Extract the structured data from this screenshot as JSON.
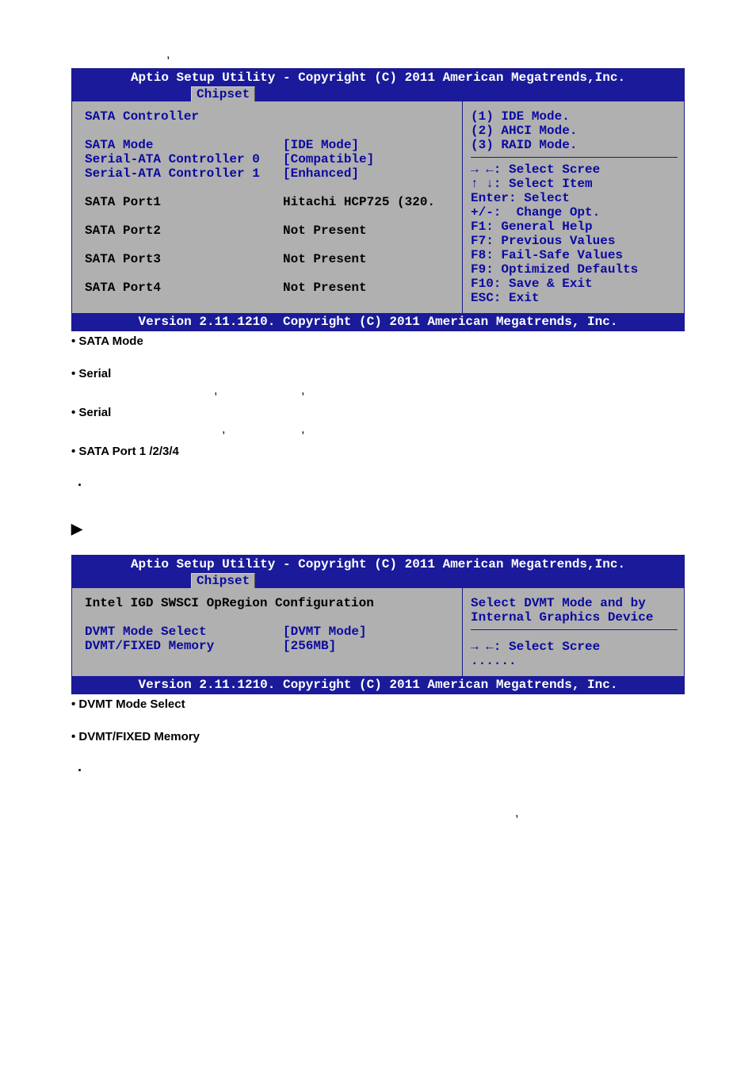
{
  "top_comma": ",",
  "bios1": {
    "header": "Aptio Setup Utility - Copyright (C) 2011 American Megatrends,Inc.",
    "tab": "Chipset",
    "rows": [
      {
        "label": "SATA Controller",
        "value": "",
        "hl": true
      },
      {
        "gap": true
      },
      {
        "label": "SATA Mode",
        "value": "[IDE Mode]",
        "hl": true
      },
      {
        "label": "Serial-ATA Controller 0",
        "value": "[Compatible]",
        "hl": true
      },
      {
        "label": "Serial-ATA Controller 1",
        "value": "[Enhanced]",
        "hl": true
      },
      {
        "gap": true
      },
      {
        "label": "SATA Port1",
        "value": "Hitachi HCP725 (320.",
        "hl": false
      },
      {
        "gap": true
      },
      {
        "label": "SATA Port2",
        "value": "Not Present",
        "hl": false
      },
      {
        "gap": true
      },
      {
        "label": "SATA Port3",
        "value": "Not Present",
        "hl": false
      },
      {
        "gap": true
      },
      {
        "label": "SATA Port4",
        "value": "Not Present",
        "hl": false
      }
    ],
    "help": [
      "(1) IDE Mode.",
      "(2) AHCI Mode.",
      "(3) RAID Mode.",
      "",
      "→ ←: Select Scree",
      "↑ ↓: Select Item",
      "Enter: Select",
      "+/-:  Change Opt.",
      "F1: General Help",
      "F7: Previous Values",
      "F8: Fail-Safe Values",
      "F9: Optimized Defaults",
      "F10: Save & Exit",
      "ESC: Exit"
    ],
    "footer": "Version 2.11.1210. Copyright (C) 2011 American Megatrends, Inc."
  },
  "doc_bullets1": [
    "SATA Mode",
    "Serial",
    "Serial",
    "SATA Port 1 /2/3/4"
  ],
  "commas_after_serial": [
    ",",
    ","
  ],
  "dot1": "·",
  "arrow": "▶",
  "bios2": {
    "header": "Aptio Setup Utility - Copyright (C) 2011 American Megatrends,Inc.",
    "tab": "Chipset",
    "left_title": "Intel IGD SWSCI OpRegion Configuration",
    "rows": [
      {
        "label": "DVMT Mode Select",
        "value": "[DVMT Mode]"
      },
      {
        "label": "DVMT/FIXED Memory",
        "value": "[256MB]"
      }
    ],
    "help": [
      "Select DVMT Mode and by",
      "Internal Graphics Device",
      "",
      "→ ←: Select Scree",
      "......"
    ],
    "footer": "Version 2.11.1210. Copyright (C) 2011 American Megatrends, Inc."
  },
  "doc_bullets2": [
    "DVMT Mode Select",
    "DVMT/FIXED Memory"
  ],
  "dot2": "·",
  "bottom_comma": ","
}
